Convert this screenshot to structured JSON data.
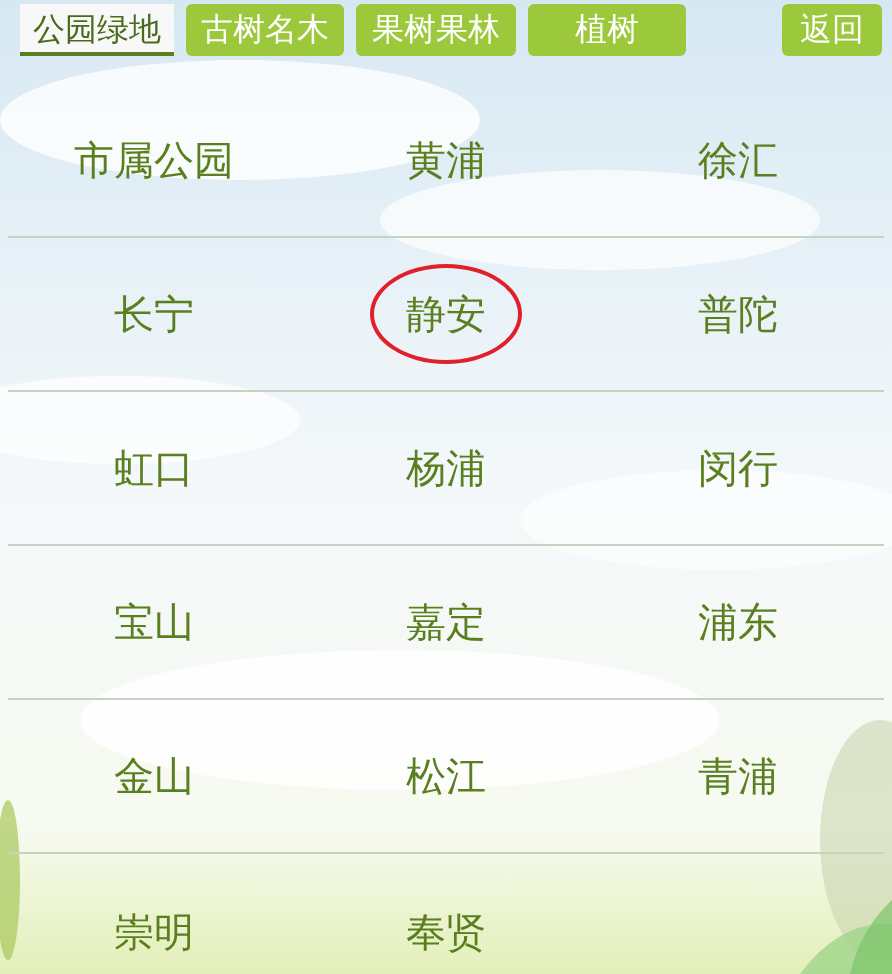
{
  "tabs": [
    {
      "label": "公园绿地",
      "selected": true
    },
    {
      "label": "古树名木",
      "selected": false
    },
    {
      "label": "果树果林",
      "selected": false
    },
    {
      "label": "植树",
      "selected": false
    }
  ],
  "back_button": "返回",
  "districts": [
    [
      {
        "name": "市属公园",
        "circled": false
      },
      {
        "name": "黄浦",
        "circled": false
      },
      {
        "name": "徐汇",
        "circled": false
      }
    ],
    [
      {
        "name": "长宁",
        "circled": false
      },
      {
        "name": "静安",
        "circled": true
      },
      {
        "name": "普陀",
        "circled": false
      }
    ],
    [
      {
        "name": "虹口",
        "circled": false
      },
      {
        "name": "杨浦",
        "circled": false
      },
      {
        "name": "闵行",
        "circled": false
      }
    ],
    [
      {
        "name": "宝山",
        "circled": false
      },
      {
        "name": "嘉定",
        "circled": false
      },
      {
        "name": "浦东",
        "circled": false
      }
    ],
    [
      {
        "name": "金山",
        "circled": false
      },
      {
        "name": "松江",
        "circled": false
      },
      {
        "name": "青浦",
        "circled": false
      }
    ],
    [
      {
        "name": "崇明",
        "circled": false
      },
      {
        "name": "奉贤",
        "circled": false
      }
    ]
  ]
}
